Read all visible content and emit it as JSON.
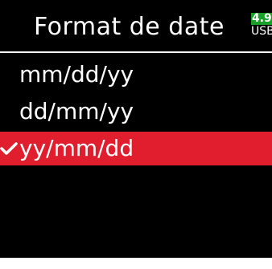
{
  "header": {
    "title": "Format de date",
    "battery_level": "4.9",
    "power_source": "USB"
  },
  "menu": {
    "items": [
      {
        "label": "mm/dd/yy",
        "selected": false
      },
      {
        "label": "dd/mm/yy",
        "selected": false
      },
      {
        "label": "yy/mm/dd",
        "selected": true
      }
    ],
    "selected_icon": "checkmark-icon"
  },
  "colors": {
    "background": "#000000",
    "text": "#ffffff",
    "selection": "#e01e2e",
    "battery": "#18a028"
  }
}
